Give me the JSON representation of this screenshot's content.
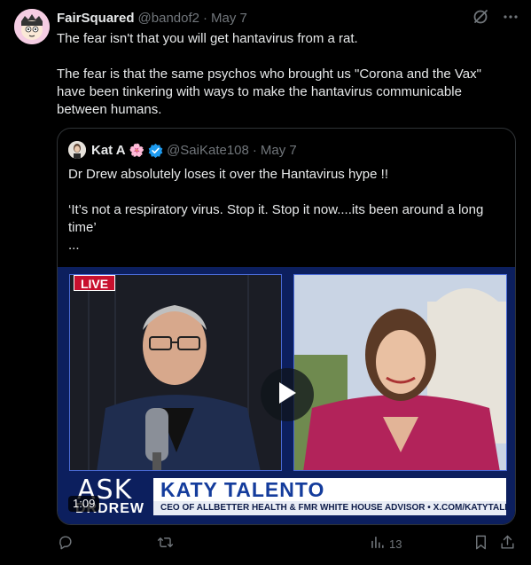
{
  "author": {
    "name": "FairSquared",
    "handle": "@bandof2",
    "separator": "·",
    "time": "May 7"
  },
  "tweet": {
    "line1": "The fear isn't that you will get hantavirus from a rat.",
    "line2": "The fear is that the same psychos who brought us \"Corona and the Vax\" have been tinkering with ways to make the hantavirus communicable between humans."
  },
  "top_icons": [
    "grok-icon",
    "more-icon"
  ],
  "quote": {
    "name": "Kat A",
    "flower": "🌸",
    "handle": "@SaiKate108",
    "separator": "·",
    "time": "May 7",
    "line1": "Dr Drew absolutely loses it over the Hantavirus hype !!",
    "line2": "‘It’s not a respiratory virus. Stop it. Stop it now....its been around a long time’",
    "line3": "..."
  },
  "video": {
    "live_label": "LIVE",
    "ask_big": "ASK",
    "ask_sub": "DRDREW",
    "lower_third_name": "KATY TALENTO",
    "lower_third_title": "CEO OF ALLBETTER HEALTH & FMR WHITE HOUSE ADVISOR • X.COM/KATYTALENTO",
    "duration": "1:09"
  },
  "actions": {
    "views_count": "13"
  },
  "colors": {
    "accent_blue": "#1d9bf0",
    "muted": "#71767b",
    "border": "#2f3336"
  }
}
